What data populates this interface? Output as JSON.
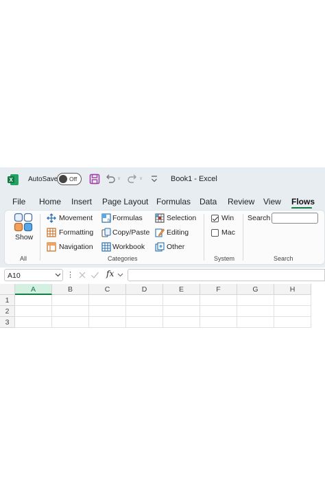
{
  "titlebar": {
    "autosave_label": "AutoSave",
    "autosave_state": "Off",
    "title": "Book1  -  Excel"
  },
  "tabs": [
    {
      "label": "File"
    },
    {
      "label": "Home"
    },
    {
      "label": "Insert"
    },
    {
      "label": "Page Layout"
    },
    {
      "label": "Formulas"
    },
    {
      "label": "Data"
    },
    {
      "label": "Review"
    },
    {
      "label": "View"
    },
    {
      "label": "Flows",
      "active": true
    }
  ],
  "ribbon": {
    "all": {
      "show_label": "Show",
      "group_label": "All"
    },
    "categories": {
      "group_label": "Categories",
      "items": [
        {
          "label": "Movement",
          "icon": "move-arrows-icon"
        },
        {
          "label": "Formatting",
          "icon": "formatting-table-icon"
        },
        {
          "label": "Navigation",
          "icon": "navigation-icon"
        },
        {
          "label": "Formulas",
          "icon": "formulas-icon"
        },
        {
          "label": "Copy/Paste",
          "icon": "copy-paste-icon"
        },
        {
          "label": "Workbook",
          "icon": "workbook-grid-icon"
        },
        {
          "label": "Selection",
          "icon": "selection-grid-icon"
        },
        {
          "label": "Editing",
          "icon": "edit-pencil-icon"
        },
        {
          "label": "Other",
          "icon": "other-icon"
        }
      ]
    },
    "system": {
      "group_label": "System",
      "win_label": "Win",
      "win_checked": true,
      "mac_label": "Mac",
      "mac_checked": false
    },
    "search": {
      "group_label": "Search",
      "label": "Search",
      "value": ""
    }
  },
  "formula_bar": {
    "name_box": "A10",
    "fx": "fx",
    "dots": "⋮",
    "value": ""
  },
  "grid": {
    "columns": [
      "A",
      "B",
      "C",
      "D",
      "E",
      "F",
      "G",
      "H"
    ],
    "rows": [
      "1",
      "2",
      "3"
    ],
    "selected_column": "A"
  },
  "colors": {
    "accent": "#107c41",
    "chrome": "#e8edf1",
    "save_icon": "#a33da6"
  }
}
